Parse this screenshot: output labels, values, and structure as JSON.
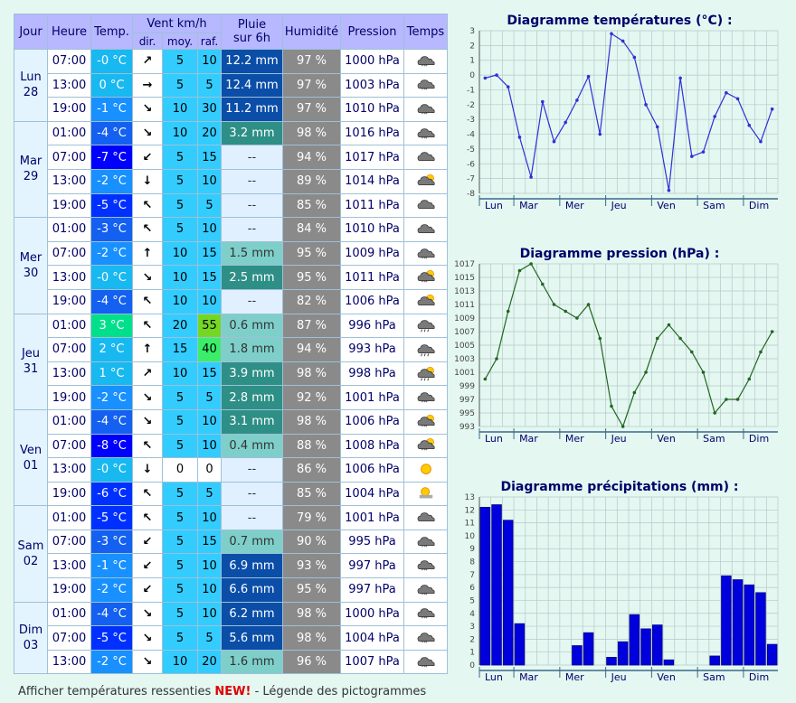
{
  "headers": {
    "jour": "Jour",
    "heure": "Heure",
    "temp": "Temp.",
    "vent": "Vent km/h",
    "dir": "dir.",
    "moy": "moy.",
    "raf": "raf.",
    "pluie_line1": "Pluie",
    "pluie_line2": "sur 6h",
    "humidite": "Humidité",
    "pression": "Pression",
    "temps": "Temps"
  },
  "days": [
    {
      "name": "Lun",
      "num": "28",
      "rows": [
        {
          "hour": "07:00",
          "temp": "-0 °C",
          "dir": "↗",
          "moy": "5",
          "raf": "10",
          "rain": "12.2 mm",
          "hum": "97 %",
          "press": "1000 hPa",
          "icon": "snow-cloud-icon"
        },
        {
          "hour": "13:00",
          "temp": "0 °C",
          "dir": "→",
          "moy": "5",
          "raf": "5",
          "rain": "12.4 mm",
          "hum": "97 %",
          "press": "1003 hPa",
          "icon": "snow-cloud-icon"
        },
        {
          "hour": "19:00",
          "temp": "-1 °C",
          "dir": "↘",
          "moy": "10",
          "raf": "30",
          "rain": "11.2 mm",
          "hum": "97 %",
          "press": "1010 hPa",
          "icon": "snow-cloud-icon"
        }
      ]
    },
    {
      "name": "Mar",
      "num": "29",
      "rows": [
        {
          "hour": "01:00",
          "temp": "-4 °C",
          "dir": "↘",
          "moy": "10",
          "raf": "20",
          "rain": "3.2 mm",
          "hum": "98 %",
          "press": "1016 hPa",
          "icon": "snow-cloud-icon"
        },
        {
          "hour": "07:00",
          "temp": "-7 °C",
          "dir": "↙",
          "moy": "5",
          "raf": "15",
          "rain": "--",
          "hum": "94 %",
          "press": "1017 hPa",
          "icon": "overcast-cloud-icon"
        },
        {
          "hour": "13:00",
          "temp": "-2 °C",
          "dir": "↓",
          "moy": "5",
          "raf": "10",
          "rain": "--",
          "hum": "89 %",
          "press": "1014 hPa",
          "icon": "sun-cloud-icon"
        },
        {
          "hour": "19:00",
          "temp": "-5 °C",
          "dir": "↖",
          "moy": "5",
          "raf": "5",
          "rain": "--",
          "hum": "85 %",
          "press": "1011 hPa",
          "icon": "overcast-cloud-icon"
        }
      ]
    },
    {
      "name": "Mer",
      "num": "30",
      "rows": [
        {
          "hour": "01:00",
          "temp": "-3 °C",
          "dir": "↖",
          "moy": "5",
          "raf": "10",
          "rain": "--",
          "hum": "84 %",
          "press": "1010 hPa",
          "icon": "overcast-cloud-icon"
        },
        {
          "hour": "07:00",
          "temp": "-2 °C",
          "dir": "↑",
          "moy": "10",
          "raf": "15",
          "rain": "1.5 mm",
          "hum": "95 %",
          "press": "1009 hPa",
          "icon": "snow-cloud-icon"
        },
        {
          "hour": "13:00",
          "temp": "-0 °C",
          "dir": "↘",
          "moy": "10",
          "raf": "15",
          "rain": "2.5 mm",
          "hum": "95 %",
          "press": "1011 hPa",
          "icon": "sun-snow-icon"
        },
        {
          "hour": "19:00",
          "temp": "-4 °C",
          "dir": "↖",
          "moy": "10",
          "raf": "10",
          "rain": "--",
          "hum": "82 %",
          "press": "1006 hPa",
          "icon": "sun-cloud-icon"
        }
      ]
    },
    {
      "name": "Jeu",
      "num": "31",
      "rows": [
        {
          "hour": "01:00",
          "temp": "3 °C",
          "dir": "↖",
          "moy": "20",
          "raf": "55",
          "rain": "0.6 mm",
          "hum": "87 %",
          "press": "996 hPa",
          "icon": "rain-cloud-icon"
        },
        {
          "hour": "07:00",
          "temp": "2 °C",
          "dir": "↑",
          "moy": "15",
          "raf": "40",
          "rain": "1.8 mm",
          "hum": "94 %",
          "press": "993 hPa",
          "icon": "rain-cloud-icon"
        },
        {
          "hour": "13:00",
          "temp": "1 °C",
          "dir": "↗",
          "moy": "10",
          "raf": "15",
          "rain": "3.9 mm",
          "hum": "98 %",
          "press": "998 hPa",
          "icon": "sun-rain-icon"
        },
        {
          "hour": "19:00",
          "temp": "-2 °C",
          "dir": "↘",
          "moy": "5",
          "raf": "5",
          "rain": "2.8 mm",
          "hum": "92 %",
          "press": "1001 hPa",
          "icon": "snow-cloud-icon"
        }
      ]
    },
    {
      "name": "Ven",
      "num": "01",
      "rows": [
        {
          "hour": "01:00",
          "temp": "-4 °C",
          "dir": "↘",
          "moy": "5",
          "raf": "10",
          "rain": "3.1 mm",
          "hum": "98 %",
          "press": "1006 hPa",
          "icon": "sun-snow-icon"
        },
        {
          "hour": "07:00",
          "temp": "-8 °C",
          "dir": "↖",
          "moy": "5",
          "raf": "10",
          "rain": "0.4 mm",
          "hum": "88 %",
          "press": "1008 hPa",
          "icon": "sun-snow-icon"
        },
        {
          "hour": "13:00",
          "temp": "-0 °C",
          "dir": "↓",
          "moy": "0",
          "raf": "0",
          "rain": "--",
          "hum": "86 %",
          "press": "1006 hPa",
          "icon": "sun-icon"
        },
        {
          "hour": "19:00",
          "temp": "-6 °C",
          "dir": "↖",
          "moy": "5",
          "raf": "5",
          "rain": "--",
          "hum": "85 %",
          "press": "1004 hPa",
          "icon": "sun-haze-icon"
        }
      ]
    },
    {
      "name": "Sam",
      "num": "02",
      "rows": [
        {
          "hour": "01:00",
          "temp": "-5 °C",
          "dir": "↖",
          "moy": "5",
          "raf": "10",
          "rain": "--",
          "hum": "79 %",
          "press": "1001 hPa",
          "icon": "overcast-cloud-icon"
        },
        {
          "hour": "07:00",
          "temp": "-3 °C",
          "dir": "↙",
          "moy": "5",
          "raf": "15",
          "rain": "0.7 mm",
          "hum": "90 %",
          "press": "995 hPa",
          "icon": "snow-cloud-icon"
        },
        {
          "hour": "13:00",
          "temp": "-1 °C",
          "dir": "↙",
          "moy": "5",
          "raf": "10",
          "rain": "6.9 mm",
          "hum": "93 %",
          "press": "997 hPa",
          "icon": "snow-cloud-icon"
        },
        {
          "hour": "19:00",
          "temp": "-2 °C",
          "dir": "↙",
          "moy": "5",
          "raf": "10",
          "rain": "6.6 mm",
          "hum": "95 %",
          "press": "997 hPa",
          "icon": "snow-cloud-icon"
        }
      ]
    },
    {
      "name": "Dim",
      "num": "03",
      "rows": [
        {
          "hour": "01:00",
          "temp": "-4 °C",
          "dir": "↘",
          "moy": "5",
          "raf": "10",
          "rain": "6.2 mm",
          "hum": "98 %",
          "press": "1000 hPa",
          "icon": "snow-cloud-icon"
        },
        {
          "hour": "07:00",
          "temp": "-5 °C",
          "dir": "↘",
          "moy": "5",
          "raf": "5",
          "rain": "5.6 mm",
          "hum": "98 %",
          "press": "1004 hPa",
          "icon": "snow-cloud-icon"
        },
        {
          "hour": "13:00",
          "temp": "-2 °C",
          "dir": "↘",
          "moy": "10",
          "raf": "20",
          "rain": "1.6 mm",
          "hum": "96 %",
          "press": "1007 hPa",
          "icon": "snow-cloud-icon"
        }
      ]
    }
  ],
  "colors": {
    "temp_plus3": "#00e08a",
    "temp_plus2": "#18b8f0",
    "temp_plus1": "#18b8f0",
    "temp_0": "#18b8f0",
    "temp_m1": "#1890ff",
    "temp_m2": "#1890ff",
    "temp_m3": "#1460f0",
    "temp_m4": "#1460f0",
    "temp_m5": "#0030ff",
    "temp_m6": "#0030ff",
    "temp_m7": "#0000ff",
    "temp_m8": "#0000ff",
    "wind_low": "#33ccff",
    "wind_mid": "#17c9a3",
    "wind_high": "#3aee6a",
    "wind_very_high": "#74d822",
    "wind_zero": "#ffffff",
    "rain_none": "#e0f0ff",
    "rain_low": "#7ecfca",
    "rain_mid": "#2e8f86",
    "rain_high": "#0b4ea8",
    "humidity": "#8a8a8a",
    "temp_chart_line": "#3030d8",
    "pressure_chart_line": "#226622",
    "precip_bar": "#0000dd"
  },
  "chart_data": [
    {
      "type": "line",
      "title": "Diagramme températures (°C) :",
      "x_day_labels": [
        "Lun",
        "Mar",
        "Mer",
        "Jeu",
        "Ven",
        "Sam",
        "Dim"
      ],
      "ylim": [
        -8,
        3
      ],
      "yticks": [
        3,
        2,
        1,
        0,
        -1,
        -2,
        -3,
        -4,
        -5,
        -6,
        -7,
        -8
      ],
      "grid": true,
      "values": [
        -0.2,
        0,
        -0.8,
        -4.2,
        -6.9,
        -1.8,
        -4.5,
        -3.2,
        -1.7,
        -0.1,
        -4,
        2.8,
        2.3,
        1.2,
        -2,
        -3.5,
        -7.8,
        -0.2,
        -5.5,
        -5.2,
        -2.8,
        -1.2,
        -1.6,
        -3.4,
        -4.5,
        -2.3
      ]
    },
    {
      "type": "line",
      "title": "Diagramme pression (hPa) :",
      "x_day_labels": [
        "Lun",
        "Mar",
        "Mer",
        "Jeu",
        "Ven",
        "Sam",
        "Dim"
      ],
      "ylim": [
        993,
        1017
      ],
      "yticks": [
        1017,
        1015,
        1013,
        1011,
        1009,
        1007,
        1005,
        1003,
        1001,
        999,
        997,
        995,
        993
      ],
      "grid": true,
      "values": [
        1000,
        1003,
        1010,
        1016,
        1017,
        1014,
        1011,
        1010,
        1009,
        1011,
        1006,
        996,
        993,
        998,
        1001,
        1006,
        1008,
        1006,
        1004,
        1001,
        995,
        997,
        997,
        1000,
        1004,
        1007
      ]
    },
    {
      "type": "bar",
      "title": "Diagramme précipitations (mm) :",
      "x_day_labels": [
        "Lun",
        "Mar",
        "Mer",
        "Jeu",
        "Ven",
        "Sam",
        "Dim"
      ],
      "ylim": [
        0,
        13
      ],
      "yticks": [
        13,
        12,
        11,
        10,
        9,
        8,
        7,
        6,
        5,
        4,
        3,
        2,
        1,
        0
      ],
      "grid": true,
      "values": [
        12.2,
        12.4,
        11.2,
        3.2,
        0,
        0,
        0,
        0,
        1.5,
        2.5,
        0,
        0.6,
        1.8,
        3.9,
        2.8,
        3.1,
        0.4,
        0,
        0,
        0,
        0.7,
        6.9,
        6.6,
        6.2,
        5.6,
        1.6
      ]
    }
  ],
  "footer": {
    "feels_like": "Afficher températures ressenties",
    "new": "NEW!",
    "sep": " - ",
    "legend": "Légende des pictogrammes"
  }
}
